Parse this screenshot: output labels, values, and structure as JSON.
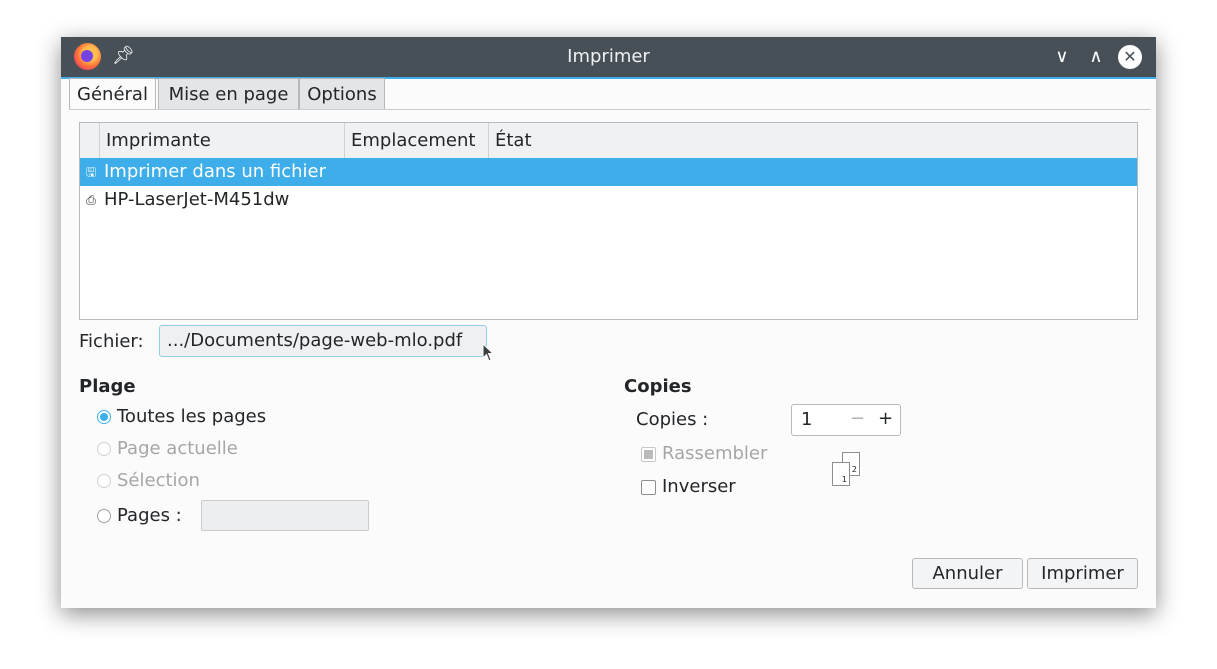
{
  "window": {
    "title": "Imprimer",
    "icons": [
      "firefox-icon",
      "pin-icon",
      "minimize-icon",
      "maximize-icon",
      "close-icon"
    ]
  },
  "tabs": [
    {
      "label": "Général",
      "active": true
    },
    {
      "label": "Mise en page",
      "active": false
    },
    {
      "label": "Options",
      "active": false
    }
  ],
  "printer_list": {
    "columns": [
      "Imprimante",
      "Emplacement",
      "État"
    ],
    "rows": [
      {
        "icon": "floppy-icon",
        "name": "Imprimer dans un fichier",
        "selected": true
      },
      {
        "icon": "printer-icon",
        "name": "HP-LaserJet-M451dw",
        "selected": false
      }
    ]
  },
  "file": {
    "label": "Fichier:",
    "value": ".../Documents/page-web-mlo.pdf"
  },
  "range": {
    "title": "Plage",
    "options": [
      {
        "label": "Toutes les pages",
        "checked": true,
        "enabled": true
      },
      {
        "label": "Page actuelle",
        "checked": false,
        "enabled": false
      },
      {
        "label": "Sélection",
        "checked": false,
        "enabled": false
      },
      {
        "label": "Pages :",
        "checked": false,
        "enabled": true
      }
    ],
    "pages_value": ""
  },
  "copies": {
    "title": "Copies",
    "label": "Copies :",
    "value": "1",
    "minus": "−",
    "plus": "+",
    "collate": {
      "label": "Rassembler",
      "checked": true,
      "enabled": false
    },
    "reverse": {
      "label": "Inverser",
      "checked": false,
      "enabled": true
    },
    "collate_sheets": [
      "1",
      "2"
    ]
  },
  "buttons": {
    "cancel": "Annuler",
    "print": "Imprimer"
  },
  "colors": {
    "titlebar": "#475057",
    "accent": "#3daee9"
  }
}
